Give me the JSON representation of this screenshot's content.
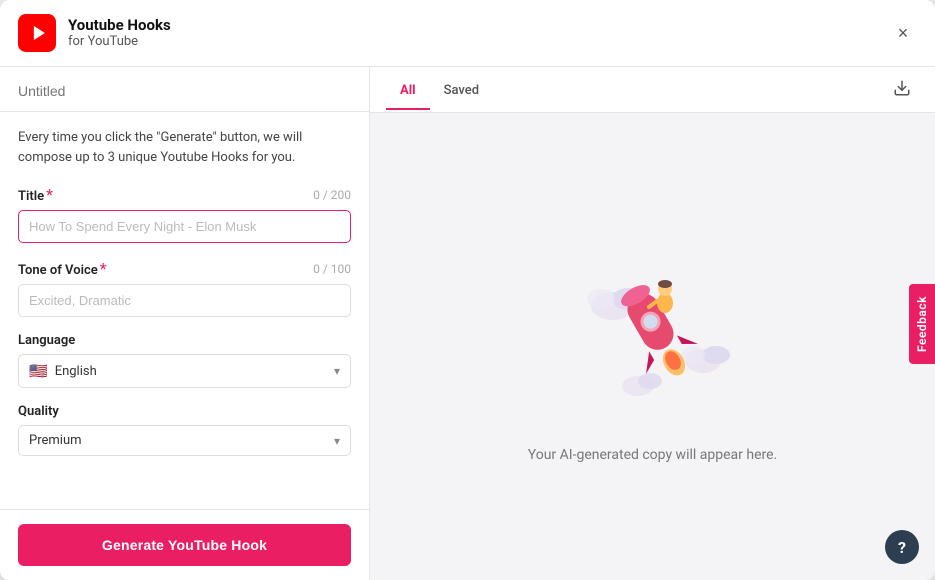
{
  "header": {
    "title": "Youtube Hooks",
    "subtitle": "for YouTube",
    "close_label": "×"
  },
  "left_panel": {
    "untitled_placeholder": "Untitled",
    "description": "Every time you click the \"Generate\" button, we will compose up to 3 unique Youtube Hooks for you.",
    "title_label": "Title",
    "title_required": "*",
    "title_char_count": "0 / 200",
    "title_placeholder": "How To Spend Every Night - Elon Musk",
    "tone_label": "Tone of Voice",
    "tone_required": "*",
    "tone_char_count": "0 / 100",
    "tone_placeholder": "Excited, Dramatic",
    "language_label": "Language",
    "language_value": "English",
    "language_flag": "🇺🇸",
    "quality_label": "Quality",
    "quality_value": "Premium",
    "generate_btn_label": "Generate YouTube Hook"
  },
  "right_panel": {
    "tabs": [
      {
        "label": "All",
        "active": true
      },
      {
        "label": "Saved",
        "active": false
      }
    ],
    "empty_text": "Your AI-generated copy will appear here.",
    "feedback_label": "Feedback"
  },
  "help_btn_label": "?"
}
